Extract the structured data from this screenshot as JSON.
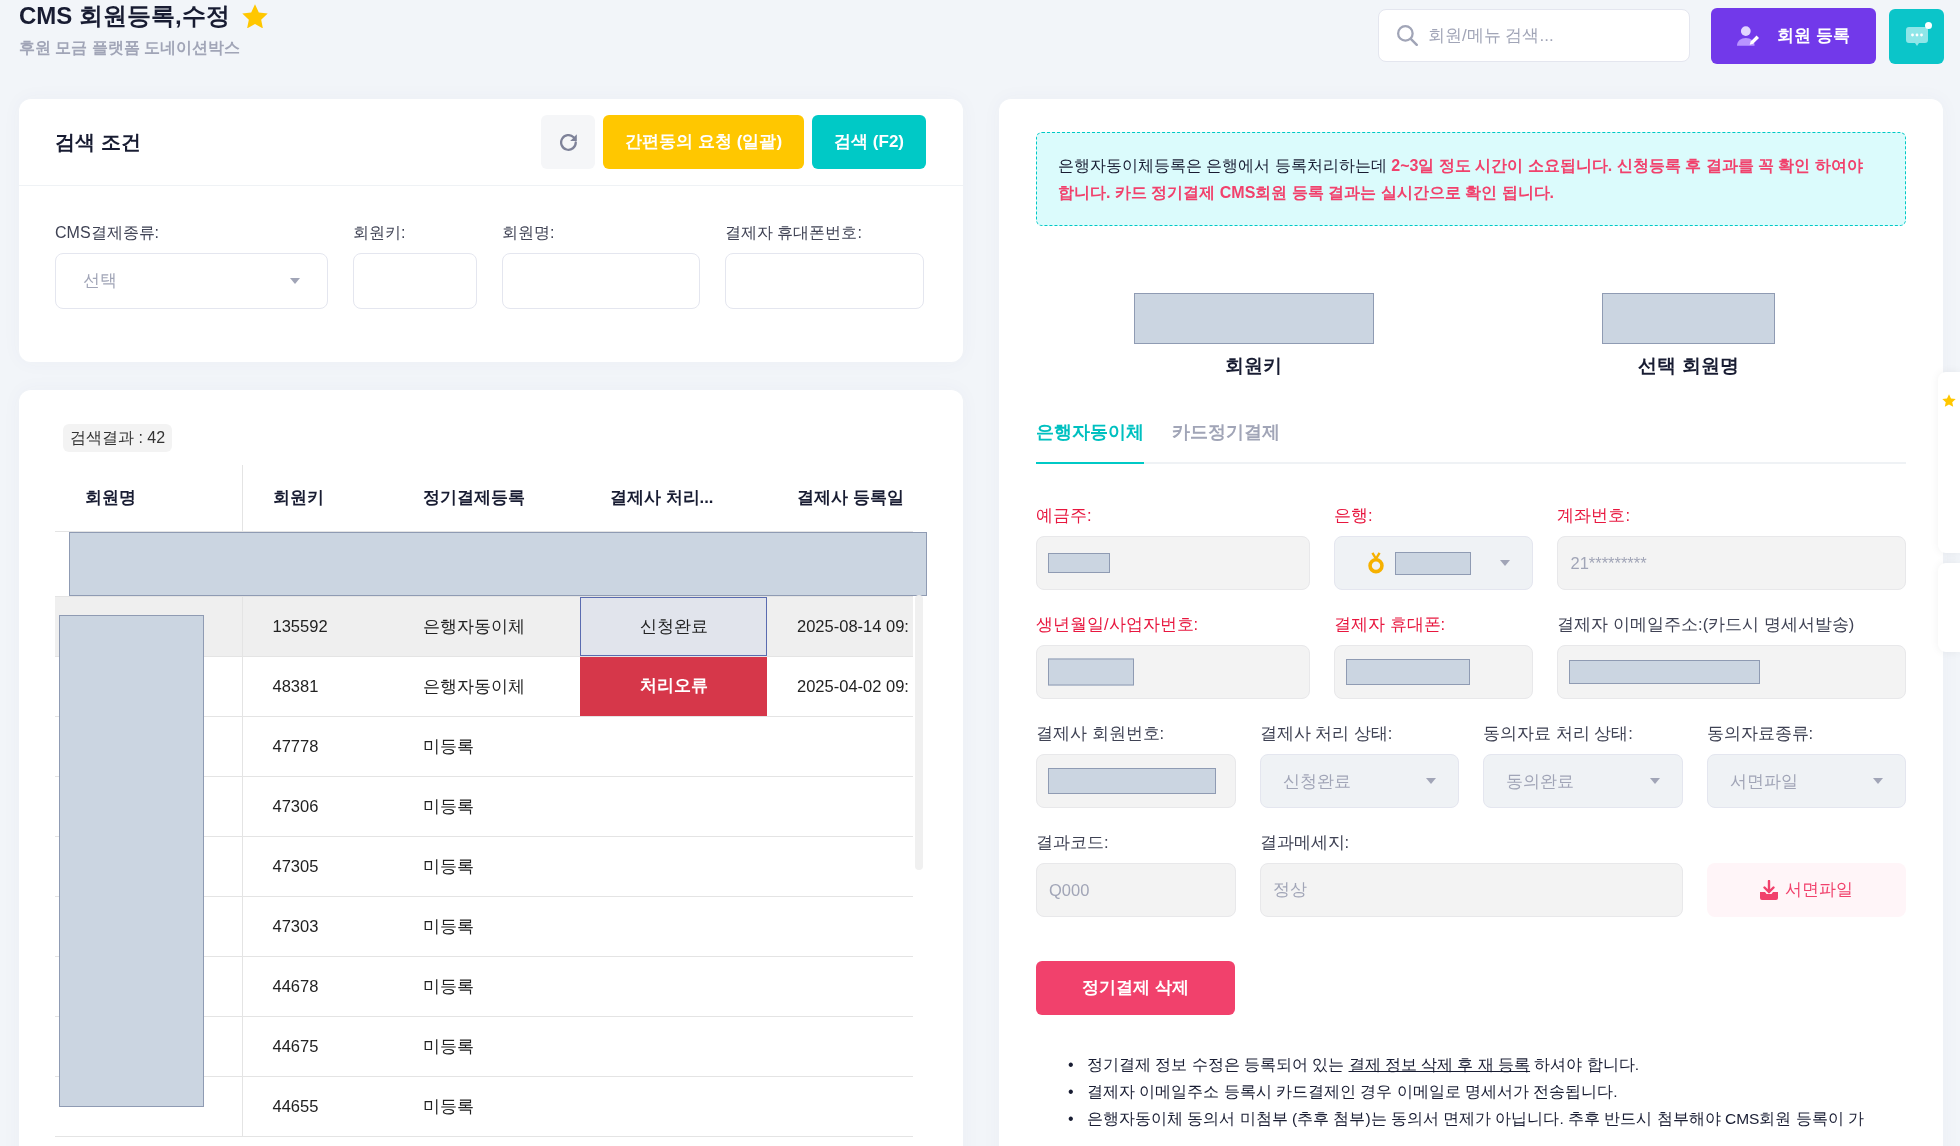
{
  "header": {
    "title": "CMS 회원등록,수정",
    "favorite": true,
    "subtitle": "후원 모금 플랫폼 도네이션박스"
  },
  "topbar": {
    "search": {
      "placeholder": "회원/메뉴 검색..."
    },
    "register_button": "회원 등록",
    "chat_unread": true
  },
  "search_panel": {
    "title": "검색 조건",
    "buttons": [
      {
        "kind": "refresh"
      },
      {
        "kind": "bulk",
        "label": "간편동의 요청 (일괄)"
      },
      {
        "kind": "search",
        "label": "검색 (F2)"
      }
    ],
    "fields": [
      {
        "kind": "select",
        "label": "CMS결제종류:",
        "placeholder": "선택"
      },
      {
        "kind": "input",
        "label": "회원키:"
      },
      {
        "kind": "input",
        "label": "회원명:"
      },
      {
        "kind": "input",
        "label": "결제자 휴대폰번호:"
      }
    ]
  },
  "results": {
    "count": "검색결과 : 42",
    "columns": [
      "회원명",
      "회원키",
      "정기결제등록",
      "결제사 처리...",
      "결제사 등록일"
    ],
    "names_redacted": true,
    "rows": [
      {
        "redacted": true,
        "selected": false
      },
      {
        "redacted": false,
        "selected": true,
        "member_key": "135592",
        "registration": "은행자동이체",
        "status": {
          "kind": "complete",
          "text": "신청완료"
        },
        "registered_at": "2025-08-14 09:"
      },
      {
        "redacted": false,
        "selected": false,
        "member_key": "48381",
        "registration": "은행자동이체",
        "status": {
          "kind": "error",
          "text": "처리오류"
        },
        "registered_at": "2025-04-02 09:"
      },
      {
        "redacted": false,
        "selected": false,
        "member_key": "47778",
        "registration": "미등록"
      },
      {
        "redacted": false,
        "selected": false,
        "member_key": "47306",
        "registration": "미등록"
      },
      {
        "redacted": false,
        "selected": false,
        "member_key": "47305",
        "registration": "미등록"
      },
      {
        "redacted": false,
        "selected": false,
        "member_key": "47303",
        "registration": "미등록"
      },
      {
        "redacted": false,
        "selected": false,
        "member_key": "44678",
        "registration": "미등록"
      },
      {
        "redacted": false,
        "selected": false,
        "member_key": "44675",
        "registration": "미등록"
      },
      {
        "redacted": false,
        "selected": false,
        "member_key": "44655",
        "registration": "미등록"
      }
    ]
  },
  "detail": {
    "notice": "은행자동이체등록은 은행에서 등록처리하는데 **2~3일 정도 시간이 소요됩니다. 신청등록 후 결과를 꼭 확인 하여야 합니다. 카드 정기결제 CMS회원 등록 결과는 실시간으로 확인 됩니다.**",
    "summary": [
      {
        "label": "회원키",
        "redacted": true
      },
      {
        "label": "선택 회원명",
        "redacted": true
      }
    ],
    "tabs": [
      {
        "label": "은행자동이체",
        "selected": true
      },
      {
        "label": "카드정기결제",
        "selected": false
      }
    ],
    "form_rows": [
      [
        {
          "kind": "input",
          "label": "예금주:",
          "required": true,
          "redacted": true
        },
        {
          "kind": "bank_select",
          "label": "은행:",
          "required": true,
          "redacted": true
        },
        {
          "kind": "input",
          "label": "계좌번호:",
          "required": true,
          "redacted": false,
          "value": "21*********"
        }
      ],
      [
        {
          "kind": "input",
          "label": "생년월일/사업자번호:",
          "required": true,
          "redacted": true
        },
        {
          "kind": "input",
          "label": "결제자 휴대폰:",
          "required": true,
          "redacted": true
        },
        {
          "kind": "input",
          "label": "결제자 이메일주소:(카드시 명세서발송)",
          "required": false,
          "redacted": true
        }
      ],
      [
        {
          "kind": "input",
          "label": "결제사 회원번호:",
          "required": false,
          "redacted": true
        },
        {
          "kind": "select",
          "label": "결제사 처리 상태:",
          "required": false,
          "redacted": false,
          "value": "신청완료"
        },
        {
          "kind": "select",
          "label": "동의자료 처리 상태:",
          "required": false,
          "redacted": false,
          "value": "동의완료"
        },
        {
          "kind": "select",
          "label": "동의자료종류:",
          "required": false,
          "redacted": false,
          "value": "서면파일"
        }
      ],
      [
        {
          "kind": "input",
          "label": "결과코드:",
          "required": false,
          "redacted": false,
          "value": "Q000"
        },
        {
          "kind": "input",
          "label": "결과메세지:",
          "required": false,
          "redacted": false,
          "value": "정상"
        },
        {
          "kind": "download",
          "button": "서면파일"
        }
      ]
    ],
    "delete_button": "정기결제 삭제",
    "notes": [
      {
        "bullet": "•",
        "parts": [
          {
            "kind": "plain",
            "text": "정기결제 정보 수정은 등록되어 있는 "
          },
          {
            "kind": "underlined",
            "text": "결제 정보 삭제 후 재 등록"
          },
          {
            "kind": "plain",
            "text": " 하셔야 합니다."
          }
        ]
      },
      {
        "bullet": "•",
        "parts": [
          {
            "kind": "plain",
            "text": "결제자 이메일주소 등록시 카드결제인 경우 이메일로 명세서가 전송됩니다."
          }
        ]
      },
      {
        "bullet": "•",
        "parts": [
          {
            "kind": "plain",
            "text": "은행자동이체 동의서 미첨부 (추후 첨부)는 동의서 면제가 아닙니다. 추후 반드시 첨부해야 CMS회원 등록이 가"
          }
        ]
      }
    ]
  },
  "side_tabs": [
    {
      "kind": "favorites"
    },
    {
      "kind": "memo"
    }
  ]
}
